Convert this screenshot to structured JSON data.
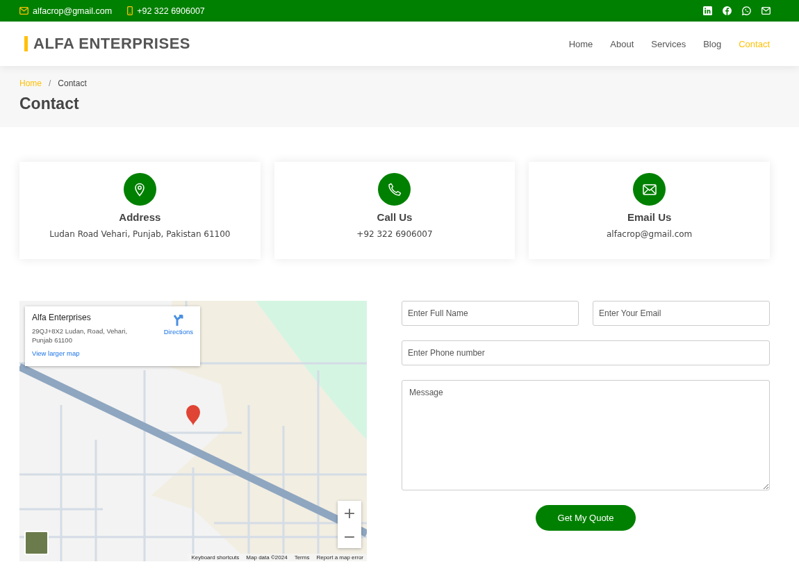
{
  "topbar": {
    "email": "alfacrop@gmail.com",
    "phone": "+92 322 6906007",
    "social": [
      {
        "kind": "linkedin"
      },
      {
        "kind": "facebook"
      },
      {
        "kind": "whatsapp"
      },
      {
        "kind": "mail"
      }
    ]
  },
  "header": {
    "logo": "ALFA ENTERPRISES",
    "nav": [
      {
        "label": "Home",
        "selected": false
      },
      {
        "label": "About",
        "selected": false
      },
      {
        "label": "Services",
        "selected": false
      },
      {
        "label": "Blog",
        "selected": false
      },
      {
        "label": "Contact",
        "selected": true
      }
    ]
  },
  "breadcrumb": {
    "items": [
      "Home",
      "Contact"
    ],
    "separator": "/",
    "title": "Contact"
  },
  "info_cards": [
    {
      "kind": "pin",
      "title": "Address",
      "text": "Ludan Road Vehari, Punjab, Pakistan 61100"
    },
    {
      "kind": "phone",
      "title": "Call Us",
      "text": "+92 322 6906007"
    },
    {
      "kind": "mail",
      "title": "Email Us",
      "text": "alfacrop@gmail.com"
    }
  ],
  "map": {
    "place_name": "Alfa Enterprises",
    "place_address": "29QJ+8X2 Ludan, Road, Vehari, Punjab 61100",
    "directions": "Directions",
    "larger_map": "View larger map",
    "zoom_in": "+",
    "zoom_out": "−",
    "footer": [
      "Keyboard shortcuts",
      "Map data ©2024",
      "Terms",
      "Report a map error"
    ]
  },
  "form": {
    "name_placeholder": "Enter Full Name",
    "email_placeholder": "Enter Your Email",
    "phone_placeholder": "Enter Phone number",
    "message_placeholder": "Message",
    "submit": "Get My Quote"
  }
}
